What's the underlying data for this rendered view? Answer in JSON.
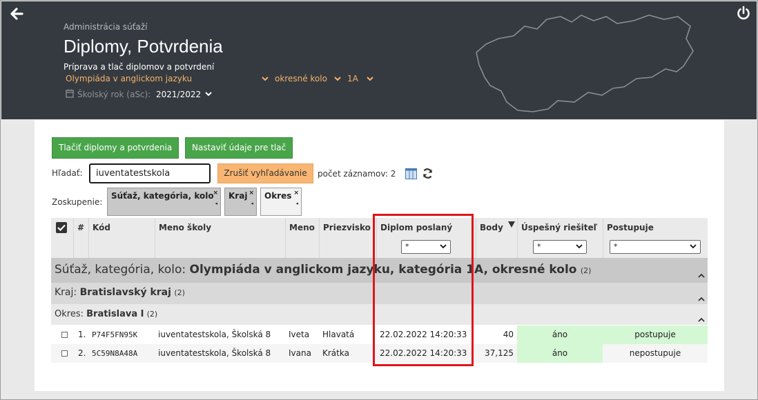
{
  "header": {
    "subtitle": "Administrácia súťaží",
    "title": "Diplomy, Potvrdenia",
    "description": "Príprava a tlač diplomov a potvrdení",
    "competition": "Olympiáda v anglickom jazyku",
    "round": "okresné kolo",
    "category": "1A",
    "school_year_label": "Školský rok (aSc):",
    "school_year_value": "2021/2022"
  },
  "toolbar": {
    "print_label": "Tlačiť diplomy a potvrdenia",
    "settings_label": "Nastaviť údaje pre tlač",
    "search_label": "Hľadať:",
    "search_value": "iuventatestskola",
    "cancel_search_label": "Zrušiť vyhľadávanie",
    "record_count": "počet záznamov: 2",
    "grouping_label": "Zoskupenie:",
    "groups": [
      "Súťaž, kategória, kolo",
      "Kraj",
      "Okres"
    ],
    "remove_glyph": "×",
    "sort_glyph": "◂"
  },
  "table": {
    "headers": {
      "num": "#",
      "code": "Kód",
      "school": "Meno školy",
      "first": "Meno",
      "last": "Priezvisko",
      "diploma": "Diplom poslaný",
      "points": "Body",
      "success": "Úspešný riešiteľ",
      "advances": "Postupuje"
    },
    "filter_value": "*",
    "group1": {
      "label": "Súťaž, kategória, kolo:",
      "value": "Olympiáda v anglickom jazyku, kategória 1A, okresné kolo",
      "count": "(2)"
    },
    "group2": {
      "label": "Kraj:",
      "value": "Bratislavský kraj",
      "count": "(2)"
    },
    "group3": {
      "label": "Okres:",
      "value": "Bratislava I",
      "count": "(2)"
    },
    "rows": [
      {
        "num": "1.",
        "code": "P74F5FN95K",
        "school": "iuventatestskola, Školská 8",
        "first": "Iveta",
        "last": "Hlavatá",
        "diploma": "22.02.2022 14:20:33",
        "points": "40",
        "success": "áno",
        "advances": "postupuje"
      },
      {
        "num": "2.",
        "code": "5C59N8A48A",
        "school": "iuventatestskola, Školská 8",
        "first": "Ivana",
        "last": "Krátka",
        "diploma": "22.02.2022 14:20:33",
        "points": "37,125",
        "success": "áno",
        "advances": "nepostupuje"
      }
    ]
  },
  "colors": {
    "header_bg": "#353a40",
    "accent_orange": "#f6b26b",
    "button_green": "#49a54a",
    "success_bg": "#d4f7d4",
    "highlight": "#e0141b"
  }
}
